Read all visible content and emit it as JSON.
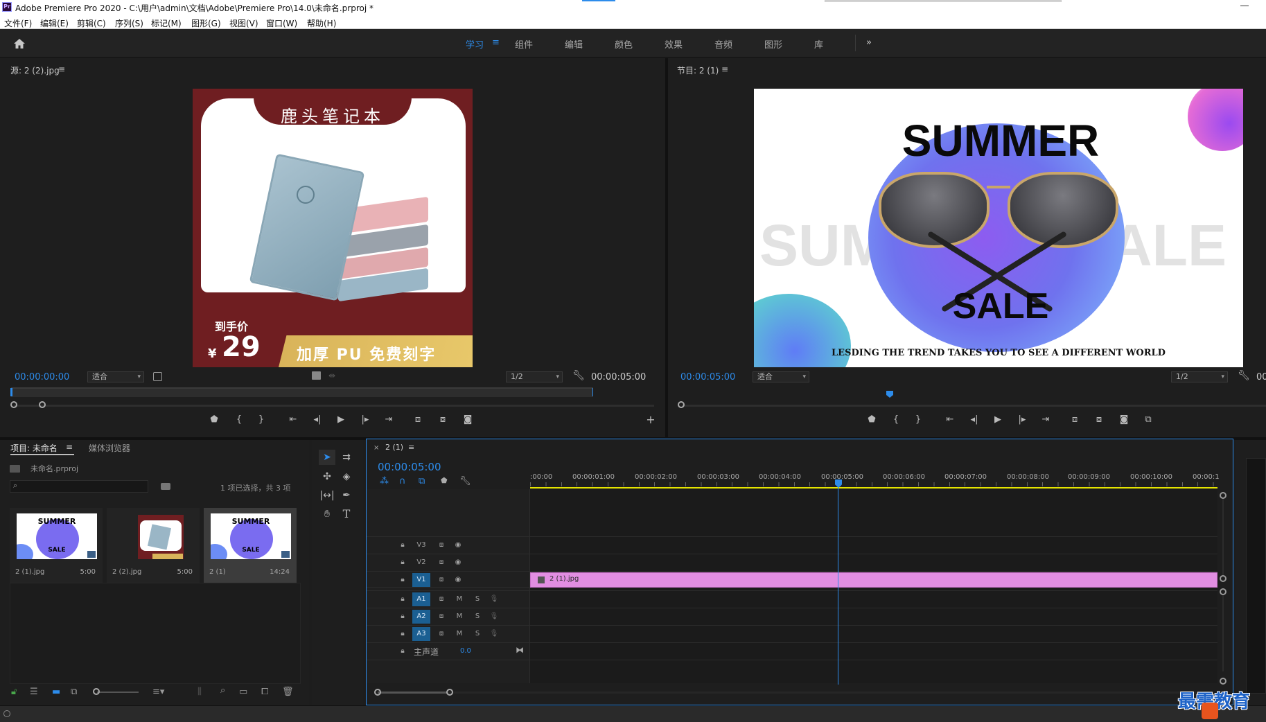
{
  "window": {
    "title": "Adobe Premiere Pro 2020 - C:\\用户\\admin\\文档\\Adobe\\Premiere Pro\\14.0\\未命名.prproj *",
    "app_badge": "Pr"
  },
  "menu": [
    "文件(F)",
    "编辑(E)",
    "剪辑(C)",
    "序列(S)",
    "标记(M)",
    "图形(G)",
    "视图(V)",
    "窗口(W)",
    "帮助(H)"
  ],
  "workspaces": {
    "items": [
      "学习",
      "组件",
      "编辑",
      "颜色",
      "效果",
      "音频",
      "图形",
      "库"
    ],
    "active": "学习",
    "more": "»"
  },
  "source": {
    "title": "源: 2 (2).jpg",
    "timecode_in": "00:00:00:00",
    "fit": "适合",
    "resolution": "1/2",
    "timecode_dur": "00:00:05:00",
    "image": {
      "header": "鹿头笔记本",
      "price_label": "到手价",
      "currency": "¥",
      "price": "29",
      "tagline": "加厚 PU 免费刻字"
    }
  },
  "program": {
    "title": "节目: 2 (1)",
    "timecode": "00:00:05:00",
    "fit": "适合",
    "resolution": "1/2",
    "timecode_end": "00",
    "image": {
      "headline": "SUMMER",
      "sub": "SALE",
      "bg_left": "SUM",
      "bg_right": "ALE",
      "caption": "LESDING THE TREND TAKES  YOU TO SEE A  DIFFERENT WORLD"
    }
  },
  "project": {
    "tab_project": "项目: 未命名",
    "tab_media": "媒体浏览器",
    "file": "未命名.prproj",
    "selection_info": "1 项已选择，共 3 项",
    "items": [
      {
        "name": "2 (1).jpg",
        "duration": "5:00",
        "kind": "sale"
      },
      {
        "name": "2 (2).jpg",
        "duration": "5:00",
        "kind": "notebook"
      },
      {
        "name": "2 (1)",
        "duration": "14:24",
        "kind": "sale"
      }
    ]
  },
  "timeline": {
    "tab": "2 (1)",
    "timecode": "00:00:05:00",
    "ruler": [
      ":00:00",
      "00:00:01:00",
      "00:00:02:00",
      "00:00:03:00",
      "00:00:04:00",
      "00:00:05:00",
      "00:00:06:00",
      "00:00:07:00",
      "00:00:08:00",
      "00:00:09:00",
      "00:00:10:00",
      "00:00:1"
    ],
    "video_tracks": [
      "V3",
      "V2",
      "V1"
    ],
    "audio_tracks": [
      "A1",
      "A2",
      "A3"
    ],
    "master": {
      "label": "主声道",
      "value": "0.0"
    },
    "clip": "2 (1).jpg",
    "mute": "M",
    "solo": "S"
  },
  "watermark": {
    "text": "最需教育"
  },
  "colors": {
    "accent": "#2d8ceb",
    "clip": "#e28ee2",
    "playhead": "#2d8ceb",
    "ruler_line": "#e5e500"
  }
}
